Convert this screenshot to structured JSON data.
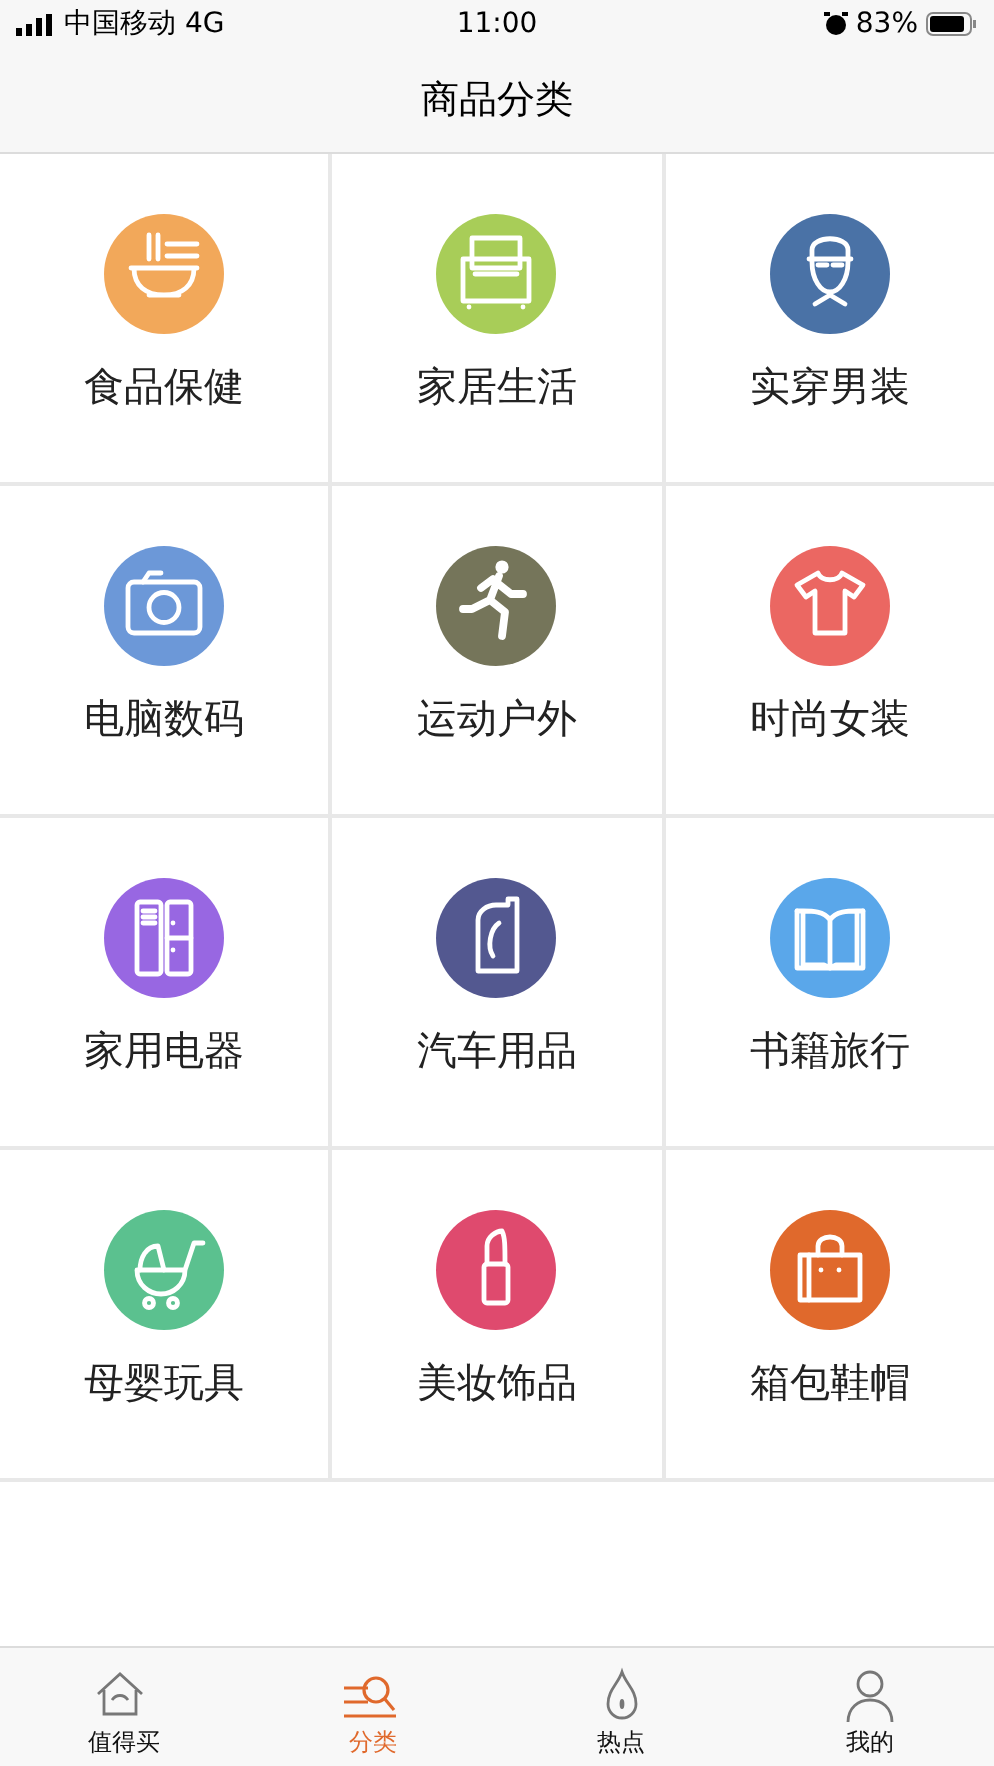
{
  "status_bar": {
    "carrier": "中国移动 4G",
    "time": "11:00",
    "battery": "83%"
  },
  "title": "商品分类",
  "categories": [
    {
      "label": "食品保健",
      "color": "#f2a85a"
    },
    {
      "label": "家居生活",
      "color": "#a8cd58"
    },
    {
      "label": "实穿男装",
      "color": "#4a72a6"
    },
    {
      "label": "电脑数码",
      "color": "#6c98d8"
    },
    {
      "label": "运动户外",
      "color": "#75755a"
    },
    {
      "label": "时尚女装",
      "color": "#eb6762"
    },
    {
      "label": "家用电器",
      "color": "#9867e2"
    },
    {
      "label": "汽车用品",
      "color": "#535890"
    },
    {
      "label": "书籍旅行",
      "color": "#5aa7ea"
    },
    {
      "label": "母婴玩具",
      "color": "#5bc18f"
    },
    {
      "label": "美妆饰品",
      "color": "#df4a6e"
    },
    {
      "label": "箱包鞋帽",
      "color": "#e0692c"
    }
  ],
  "tab_bar": [
    {
      "label": "值得买",
      "selected": false
    },
    {
      "label": "分类",
      "selected": true
    },
    {
      "label": "热点",
      "selected": false
    },
    {
      "label": "我的",
      "selected": false
    }
  ]
}
